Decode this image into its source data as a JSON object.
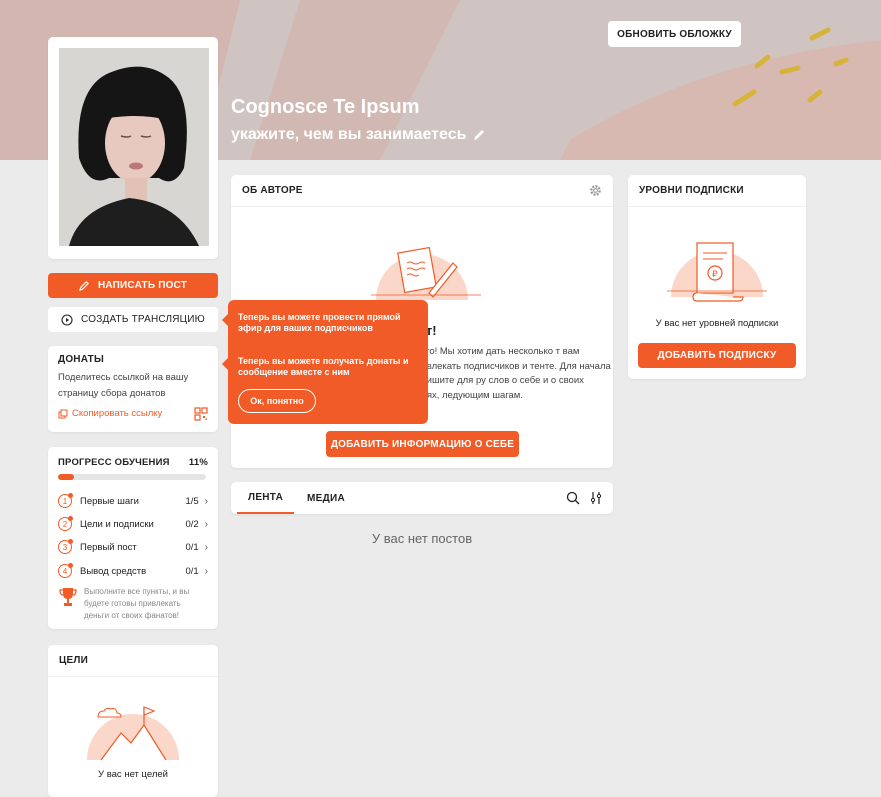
{
  "cover": {
    "update_button": "ОБНОВИТЬ ОБЛОЖКУ",
    "title": "Cognosce Te Ipsum",
    "subtitle": "укажите, чем вы занимаетесь"
  },
  "actions": {
    "write_post": "НАПИСАТЬ ПОСТ",
    "create_stream": "СОЗДАТЬ ТРАНСЛЯЦИЮ"
  },
  "donations": {
    "title": "ДОНАТЫ",
    "description": "Поделитесь ссылкой на вашу страницу сбора донатов",
    "copy_link": "Скопировать ссылку"
  },
  "progress": {
    "title": "ПРОГРЕСС ОБУЧЕНИЯ",
    "percent": "11%",
    "fraction": 0.11,
    "steps": [
      {
        "num": "1",
        "label": "Первые шаги",
        "count": "1/5"
      },
      {
        "num": "2",
        "label": "Цели и подписки",
        "count": "0/2"
      },
      {
        "num": "3",
        "label": "Первый пост",
        "count": "0/1"
      },
      {
        "num": "4",
        "label": "Вывод средств",
        "count": "0/1"
      }
    ],
    "tip": "Выполните все пункты, и вы будете готовы привлекать деньги от своих фанатов!"
  },
  "goals": {
    "title": "ЦЕЛИ",
    "empty": "У вас нет целей"
  },
  "about": {
    "title": "ОБ АВТОРЕ",
    "greeting": "вет!",
    "text": "круто! Мы хотим дать несколько т вам привлекать подписчиков и тенте. Для начала напишите для ру слов о себе и о своих целях, ледующим шагам.",
    "add_button": "ДОБАВИТЬ ИНФОРМАЦИЮ О СЕБЕ"
  },
  "feed": {
    "tabs": [
      "ЛЕНТА",
      "МЕДИА"
    ],
    "empty": "У вас нет постов"
  },
  "levels": {
    "title": "УРОВНИ ПОДПИСКИ",
    "empty": "У вас нет уровней подписки",
    "add_button": "ДОБАВИТЬ ПОДПИСКУ"
  },
  "tooltip": {
    "message1": "Теперь вы можете провести прямой эфир для ваших подписчиков",
    "message2": "Теперь вы можете получать донаты и сообщение вместе с ним",
    "ok_button": "Ок, понятно"
  },
  "colors": {
    "accent": "#f05b27",
    "cover_bg": "#cfc4c2",
    "page_bg": "#ebebeb",
    "illustration_bg": "#fbd7c9"
  }
}
